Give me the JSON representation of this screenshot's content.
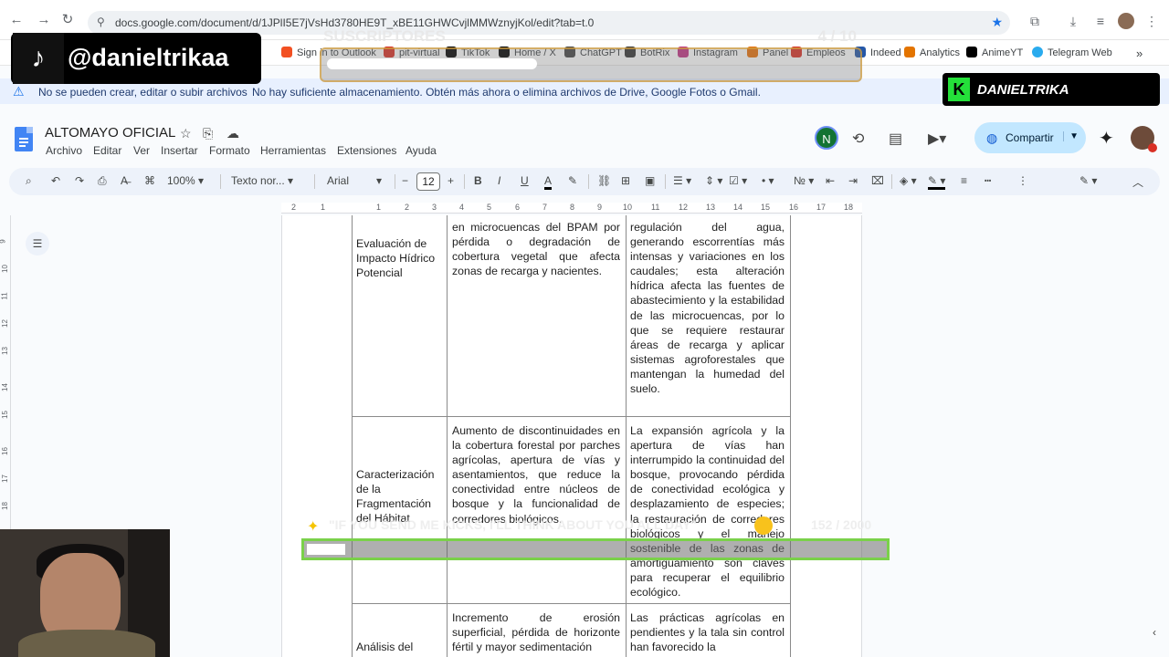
{
  "browser": {
    "url": "docs.google.com/document/d/1JPlI5E7jVsHd3780HE9T_xBE11GHWCvjlMMWznyjKol/edit?tab=t.0",
    "bookmarks": [
      "Sign in to Outlook",
      "pit-virtual",
      "TikTok",
      "Home / X",
      "ChatGPT",
      "BotRix",
      "Instagram",
      "Panel",
      "Empleos",
      "Indeed",
      "Analytics",
      "AnimeYT",
      "Telegram Web"
    ]
  },
  "warning": {
    "title": "No se pueden crear, editar o subir archivos",
    "message": "No hay suficiente almacenamiento. Obtén más ahora o elimina archivos de Drive, Google Fotos o Gmail."
  },
  "doc": {
    "title": "ALTOMAYO OFICIAL",
    "menus": [
      "Archivo",
      "Editar",
      "Ver",
      "Insertar",
      "Formato",
      "Herramientas",
      "Extensiones",
      "Ayuda"
    ],
    "avatar_initial": "N",
    "share_label": "Compartir"
  },
  "toolbar": {
    "zoom": "100%",
    "style": "Texto nor...",
    "font": "Arial",
    "font_size": "12"
  },
  "ruler": [
    "2",
    "1",
    "1",
    "2",
    "3",
    "4",
    "5",
    "6",
    "7",
    "8",
    "9",
    "10",
    "11",
    "12",
    "13",
    "14",
    "15",
    "16",
    "17",
    "18"
  ],
  "vruler": [
    "9",
    "10",
    "11",
    "12",
    "13",
    "14",
    "15",
    "16",
    "17",
    "18"
  ],
  "table": {
    "rows": [
      {
        "title": "Evaluación de Impacto Hídrico Potencial",
        "description": "en microcuencas del BPAM por pérdida o degradación de cobertura vegetal que afecta zonas de recarga y nacientes.",
        "justification": "regulación del agua, generando escorrentías más intensas y variaciones en los caudales; esta alteración hídrica afecta las fuentes de abastecimiento y la estabilidad de las microcuencas, por lo que se requiere restaurar áreas de recarga y aplicar sistemas agroforestales que mantengan la humedad del suelo."
      },
      {
        "title": "Caracterización de la Fragmentación del Hábitat",
        "description": "Aumento de discontinuidades en la cobertura forestal por parches agrícolas, apertura de vías y asentamientos, que reduce la conectividad entre núcleos de bosque y la funcionalidad de corredores biológicos.",
        "justification": "La expansión agrícola y la apertura de vías han interrumpido la continuidad del bosque, provocando pérdida de conectividad ecológica y desplazamiento de especies; la restauración de corredores biológicos y el manejo sostenible de las zonas de amortiguamiento son claves para recuperar el equilibrio ecológico."
      },
      {
        "title": "Análisis del",
        "description": "Incremento de erosión superficial, pérdida de horizonte fértil y mayor sedimentación",
        "justification": "Las prácticas agrícolas en pendientes y la tala sin control han favorecido la"
      }
    ]
  },
  "overlays": {
    "tiktok_handle": "@danieltrikaa",
    "subs_label": "SUSCRIPTORES",
    "subs_count": "4 / 10",
    "brand": "DANIELTRIKA",
    "goal_text": "\"IF YOU SEND ME KICKS, I'LL THINK ABOUT YOU ALL DAY\"",
    "goal_count": "152 / 2000"
  },
  "colors": {
    "accent": "#1a73e8",
    "share_bg": "#c2e7ff",
    "goal_border": "#7ad14a",
    "brand_green": "#24e03a"
  }
}
